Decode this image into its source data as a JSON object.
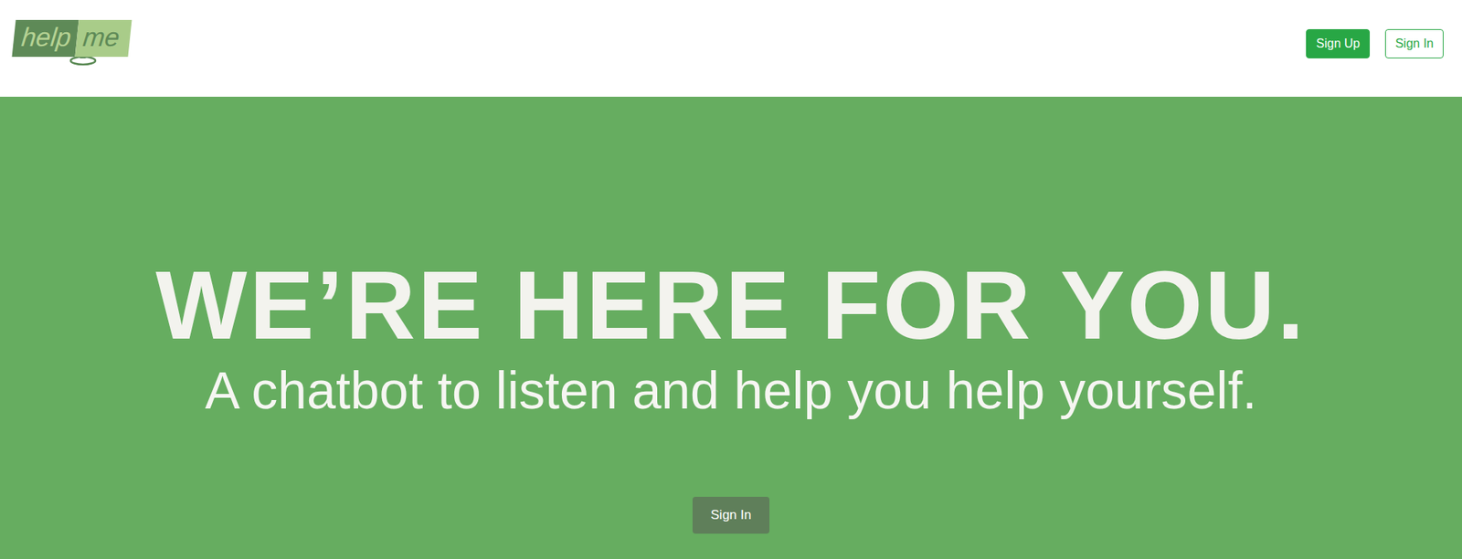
{
  "logo": {
    "left": "help",
    "right": "me"
  },
  "nav": {
    "buttons": [
      {
        "label": "Sign Up",
        "kind": "filled"
      },
      {
        "label": "Sign In",
        "kind": "outline"
      }
    ]
  },
  "hero": {
    "title": "WE’RE HERE FOR YOU.",
    "subtitle": "A chatbot to listen and help you help yourself.",
    "button": "Sign In"
  }
}
